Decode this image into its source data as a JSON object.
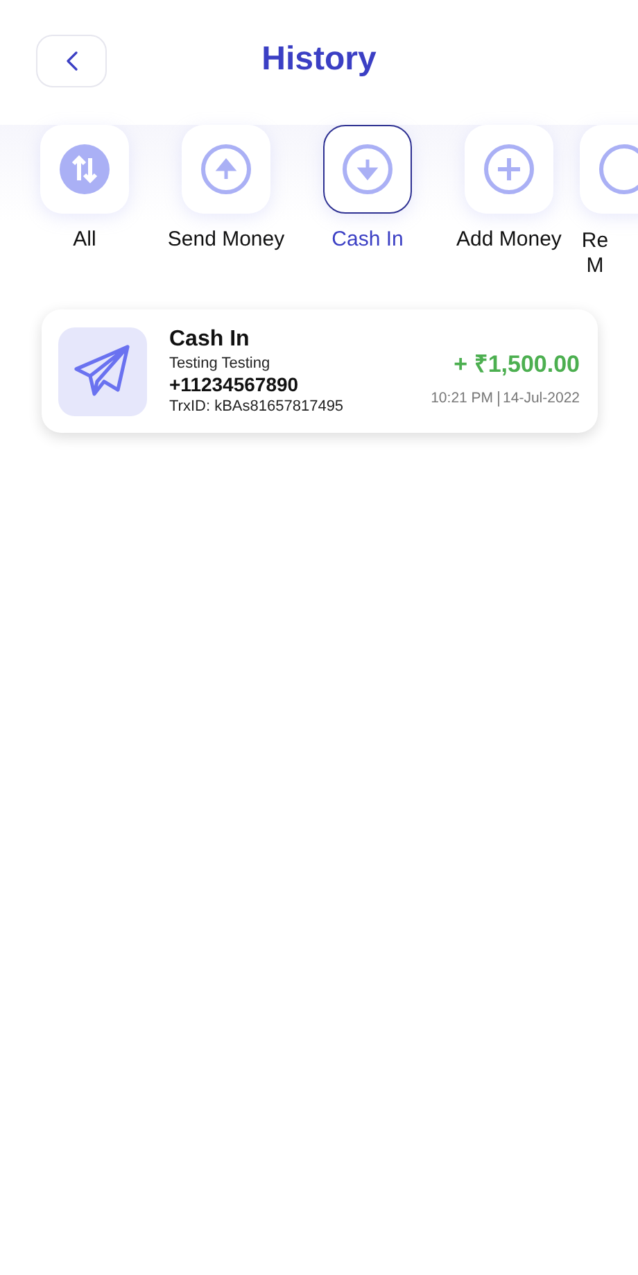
{
  "header": {
    "title": "History"
  },
  "categories": [
    {
      "label": "All",
      "kind": "all",
      "selected": false
    },
    {
      "label": "Send Money",
      "kind": "send",
      "selected": false
    },
    {
      "label": "Cash In",
      "kind": "cashin",
      "selected": true
    },
    {
      "label": "Add Money",
      "kind": "add",
      "selected": false
    },
    {
      "label": "Re M",
      "kind": "receive",
      "selected": false
    }
  ],
  "transactions": [
    {
      "type": "Cash In",
      "name": "Testing Testing",
      "phone": "+11234567890",
      "trx_id": "TrxID: kBAs81657817495",
      "amount": "+ ₹1,500.00",
      "time": "10:21 PM",
      "date": "14-Jul-2022"
    }
  ]
}
